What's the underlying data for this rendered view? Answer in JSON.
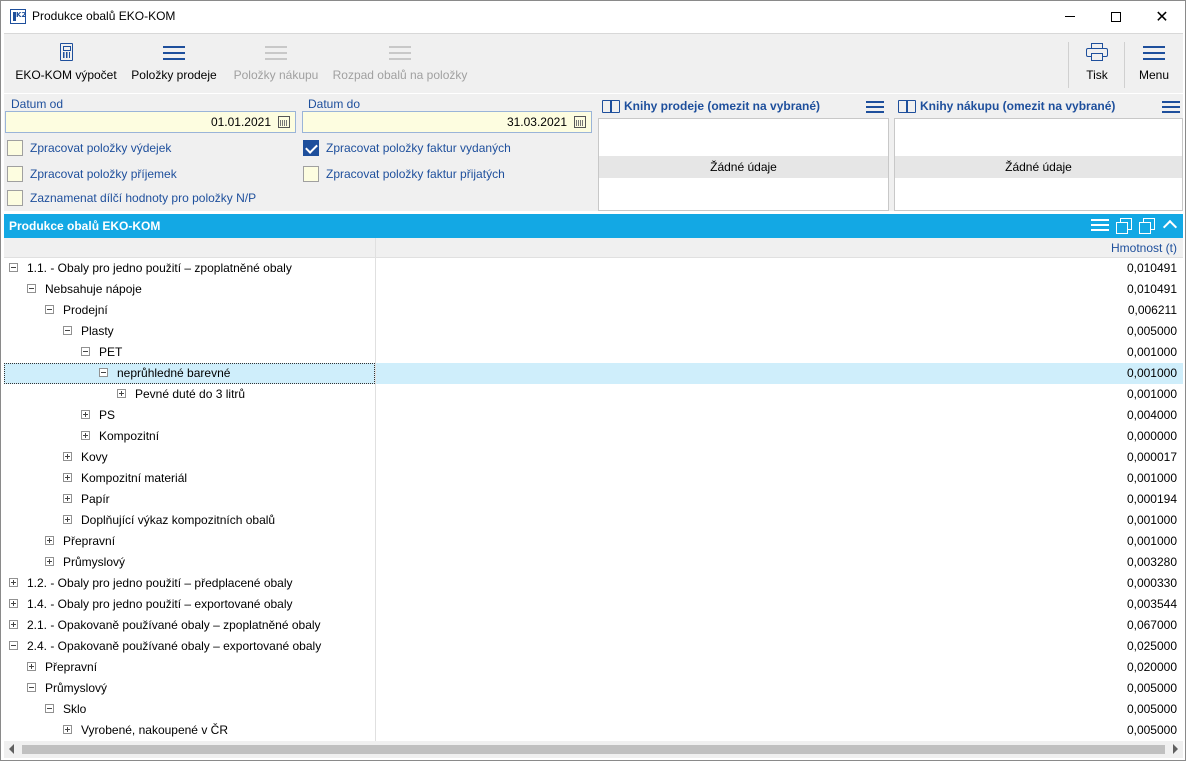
{
  "window": {
    "title": "Produkce obalů EKO-KOM"
  },
  "toolbar": {
    "ekokom": "EKO-KOM výpočet",
    "sales_items": "Položky prodeje",
    "purchase_items": "Položky nákupu",
    "breakdown": "Rozpad obalů na položky",
    "print": "Tisk",
    "menu": "Menu"
  },
  "filter": {
    "date_from_label": "Datum od",
    "date_from": "01.01.2021",
    "date_to_label": "Datum do",
    "date_to": "31.03.2021",
    "chk_issue": {
      "label": "Zpracovat položky výdejek",
      "checked": false
    },
    "chk_receipt": {
      "label": "Zpracovat položky příjemek",
      "checked": false
    },
    "chk_partial": {
      "label": "Zaznamenat dílčí hodnoty pro položky N/P",
      "checked": false
    },
    "chk_issued_invoices": {
      "label": "Zpracovat položky faktur vydaných",
      "checked": true
    },
    "chk_received_invoices": {
      "label": "Zpracovat položky faktur přijatých",
      "checked": false
    }
  },
  "sales_books": {
    "title": "Knihy prodeje (omezit na vybrané)",
    "empty": "Žádné údaje"
  },
  "purchase_books": {
    "title": "Knihy nákupu (omezit na vybrané)",
    "empty": "Žádné údaje"
  },
  "grid": {
    "title": "Produkce obalů EKO-KOM",
    "weight_header": "Hmotnost (t)",
    "rows": [
      {
        "label": "1.1. - Obaly pro jedno použití – zpoplatněné obaly",
        "value": "0,010491",
        "level": 0,
        "state": "minus"
      },
      {
        "label": "Nebsahuje nápoje",
        "value": "0,010491",
        "level": 1,
        "state": "minus"
      },
      {
        "label": "Prodejní",
        "value": "0,006211",
        "level": 2,
        "state": "minus"
      },
      {
        "label": "Plasty",
        "value": "0,005000",
        "level": 3,
        "state": "minus"
      },
      {
        "label": "PET",
        "value": "0,001000",
        "level": 4,
        "state": "minus"
      },
      {
        "label": "neprůhledné barevné",
        "value": "0,001000",
        "level": 5,
        "state": "minus",
        "selected": true
      },
      {
        "label": "Pevné duté do 3 litrů",
        "value": "0,001000",
        "level": 6,
        "state": "plus"
      },
      {
        "label": "PS",
        "value": "0,004000",
        "level": 4,
        "state": "plus"
      },
      {
        "label": "Kompozitní",
        "value": "0,000000",
        "level": 4,
        "state": "plus"
      },
      {
        "label": "Kovy",
        "value": "0,000017",
        "level": 3,
        "state": "plus"
      },
      {
        "label": "Kompozitní materiál",
        "value": "0,001000",
        "level": 3,
        "state": "plus"
      },
      {
        "label": "Papír",
        "value": "0,000194",
        "level": 3,
        "state": "plus"
      },
      {
        "label": "Doplňující výkaz kompozitních obalů",
        "value": "0,001000",
        "level": 3,
        "state": "plus"
      },
      {
        "label": "Přepravní",
        "value": "0,001000",
        "level": 2,
        "state": "plus"
      },
      {
        "label": "Průmyslový",
        "value": "0,003280",
        "level": 2,
        "state": "plus"
      },
      {
        "label": "1.2. - Obaly pro jedno použití – předplacené obaly",
        "value": "0,000330",
        "level": 0,
        "state": "plus"
      },
      {
        "label": "1.4. - Obaly pro jedno použití – exportované obaly",
        "value": "0,003544",
        "level": 0,
        "state": "plus"
      },
      {
        "label": "2.1. - Opakovaně používané obaly – zpoplatněné obaly",
        "value": "0,067000",
        "level": 0,
        "state": "plus"
      },
      {
        "label": "2.4. - Opakovaně používané obaly – exportované obaly",
        "value": "0,025000",
        "level": 0,
        "state": "minus"
      },
      {
        "label": "Přepravní",
        "value": "0,020000",
        "level": 1,
        "state": "plus"
      },
      {
        "label": "Průmyslový",
        "value": "0,005000",
        "level": 1,
        "state": "minus"
      },
      {
        "label": "Sklo",
        "value": "0,005000",
        "level": 2,
        "state": "minus"
      },
      {
        "label": "Vyrobené, nakoupené v ČR",
        "value": "0,005000",
        "level": 3,
        "state": "plus"
      }
    ]
  }
}
